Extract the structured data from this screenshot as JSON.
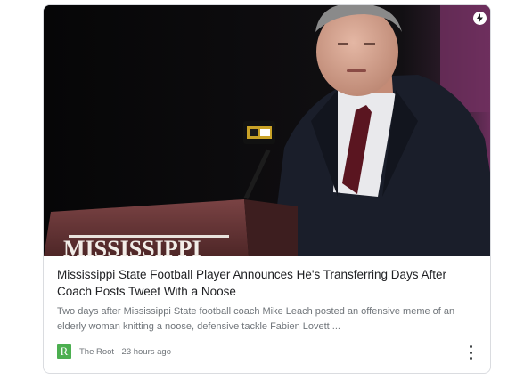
{
  "article": {
    "title": "Mississippi State Football Player Announces He's Transferring Days After Coach Posts Tweet With a Noose",
    "snippet": "Two days after Mississippi State football coach Mike Leach posted an offensive meme of an elderly woman knitting a noose, defensive tackle Fabien Lovett ...",
    "source": "The Root",
    "separator": " · ",
    "timestamp": "23 hours ago",
    "favicon_letter": "R",
    "podium_text": "MISSISSIPPI",
    "icons": {
      "amp": "lightning-bolt-icon",
      "more": "more-vert-icon"
    },
    "colors": {
      "favicon_bg": "#4caf50",
      "podium": "#6b3a3b",
      "background_right": "#6e2f5e"
    }
  }
}
